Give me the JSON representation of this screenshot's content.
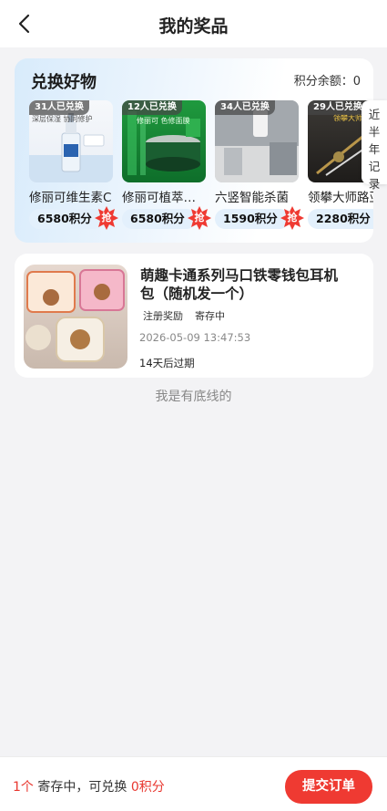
{
  "header": {
    "title": "我的奖品",
    "back_icon": "chevron-left-icon"
  },
  "exchange": {
    "title": "兑换好物",
    "balance_label": "积分余额：0",
    "side_tab": [
      "近",
      "半",
      "年",
      "记",
      "录"
    ],
    "grab_label": "抢",
    "items": [
      {
        "badge": "31人已兑换",
        "name": "修丽可维生素C",
        "price": "6580积分",
        "img_text": "深层保湿 协同修护"
      },
      {
        "badge": "12人已兑换",
        "name": "修丽可植萃精华",
        "price": "6580积分",
        "img_text": "修丽可 色修面膜"
      },
      {
        "badge": "34人已兑换",
        "name": "六竖智能杀菌",
        "price": "1590积分",
        "img_text": ""
      },
      {
        "badge": "29人已兑换",
        "name": "领攀大师路亚",
        "price": "2280积分",
        "img_text": "领攀大师"
      }
    ],
    "colors": {
      "accent": "#ef3a32",
      "price_bg": "#e3f0fc"
    }
  },
  "prize": {
    "title": "萌趣卡通系列马口铁零钱包耳机包（随机发一个）",
    "tags": [
      "注册奖励",
      "寄存中"
    ],
    "time": "2026-05-09 13:47:53",
    "expire": "14天后过期"
  },
  "list_end": "我是有底线的",
  "footer": {
    "count": "1个",
    "middle": " 寄存中，可兑换 ",
    "points": "0积分",
    "submit_label": "提交订单"
  }
}
